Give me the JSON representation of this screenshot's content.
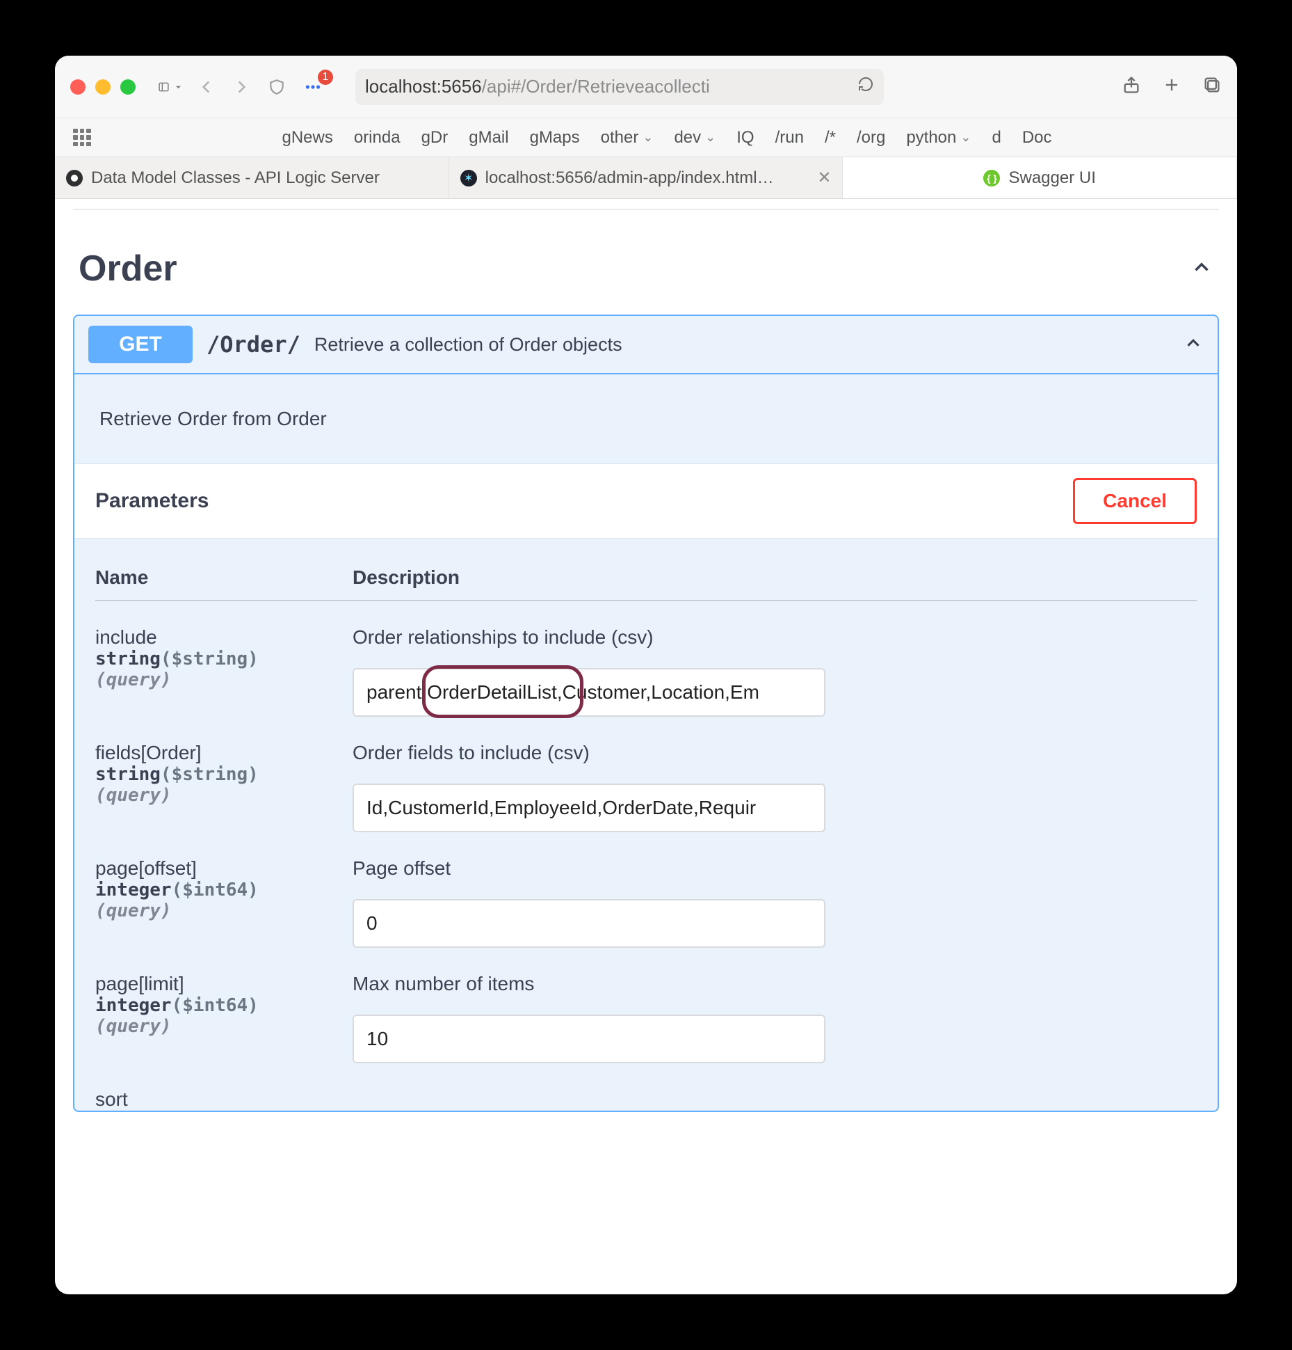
{
  "browser": {
    "badge_count": "1",
    "url_prefix": "localhost:5656",
    "url_suffix": "/api#/Order/Retrieveacollecti",
    "bookmarks": [
      "gNews",
      "orinda",
      "gDr",
      "gMail",
      "gMaps",
      "other",
      "dev",
      "IQ",
      "/run",
      "/*",
      "/org",
      "python",
      "d",
      "Doc"
    ],
    "bookmark_menus": [
      "other",
      "dev",
      "python"
    ]
  },
  "tabs": [
    {
      "label": "Data Model Classes - API Logic Server",
      "favicon": "#2f2f31"
    },
    {
      "label": "localhost:5656/admin-app/index.html…",
      "favicon": "#1c212b"
    },
    {
      "label": "Swagger UI",
      "favicon": "#6ec72c"
    }
  ],
  "section": {
    "title": "Order"
  },
  "operation": {
    "method": "GET",
    "path": "/Order/",
    "summary": "Retrieve a collection of Order objects",
    "note": "Retrieve Order from Order",
    "parameters_label": "Parameters",
    "cancel_label": "Cancel",
    "col_name": "Name",
    "col_desc": "Description"
  },
  "params": [
    {
      "name": "include",
      "type": "string",
      "format": "($string)",
      "location": "(query)",
      "desc": "Order relationships to include (csv)",
      "value": "parent,OrderDetailList,Customer,Location,Em",
      "highlighted_substring": "OrderDetailList"
    },
    {
      "name": "fields[Order]",
      "type": "string",
      "format": "($string)",
      "location": "(query)",
      "desc": "Order fields to include (csv)",
      "value": "Id,CustomerId,EmployeeId,OrderDate,Requir"
    },
    {
      "name": "page[offset]",
      "type": "integer",
      "format": "($int64)",
      "location": "(query)",
      "desc": "Page offset",
      "value": "0"
    },
    {
      "name": "page[limit]",
      "type": "integer",
      "format": "($int64)",
      "location": "(query)",
      "desc": "Max number of items",
      "value": "10"
    }
  ],
  "trailing_param_name": "sort"
}
